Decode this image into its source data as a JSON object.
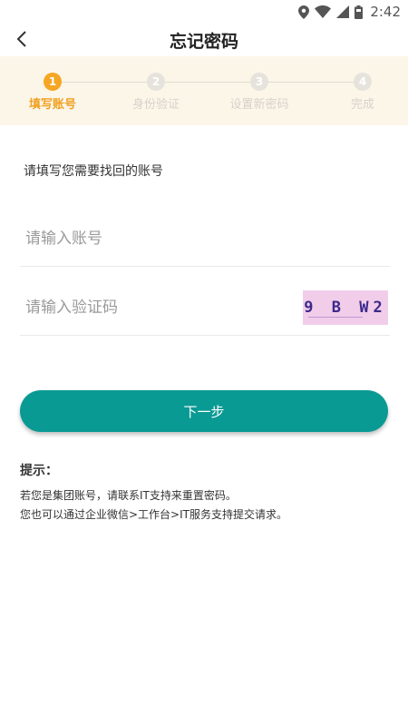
{
  "status_bar": {
    "time": "2:42",
    "icons": [
      "location-icon",
      "wifi-icon",
      "signal-icon",
      "battery-icon"
    ]
  },
  "header": {
    "back_icon": "chevron-left-icon",
    "title": "忘记密码"
  },
  "steps": [
    {
      "number": "1",
      "label": "填写账号",
      "active": true
    },
    {
      "number": "2",
      "label": "身份验证",
      "active": false
    },
    {
      "number": "3",
      "label": "设置新密码",
      "active": false
    },
    {
      "number": "4",
      "label": "完成",
      "active": false
    }
  ],
  "form": {
    "prompt": "请填写您需要找回的账号",
    "account_placeholder": "请输入账号",
    "code_placeholder": "请输入验证码",
    "captcha_text": "9 B W2"
  },
  "next_button": {
    "label": "下一步"
  },
  "tips": {
    "title": "提示：",
    "lines": [
      "若您是集团账号，请联系IT支持来重置密码。",
      "您也可以通过企业微信>工作台>IT服务支持提交请求。"
    ]
  },
  "colors": {
    "accent": "#0a9a94",
    "step_active": "#f5a623",
    "stepper_bg": "#fcf6e9",
    "captcha_bg": "#f2cdea"
  }
}
